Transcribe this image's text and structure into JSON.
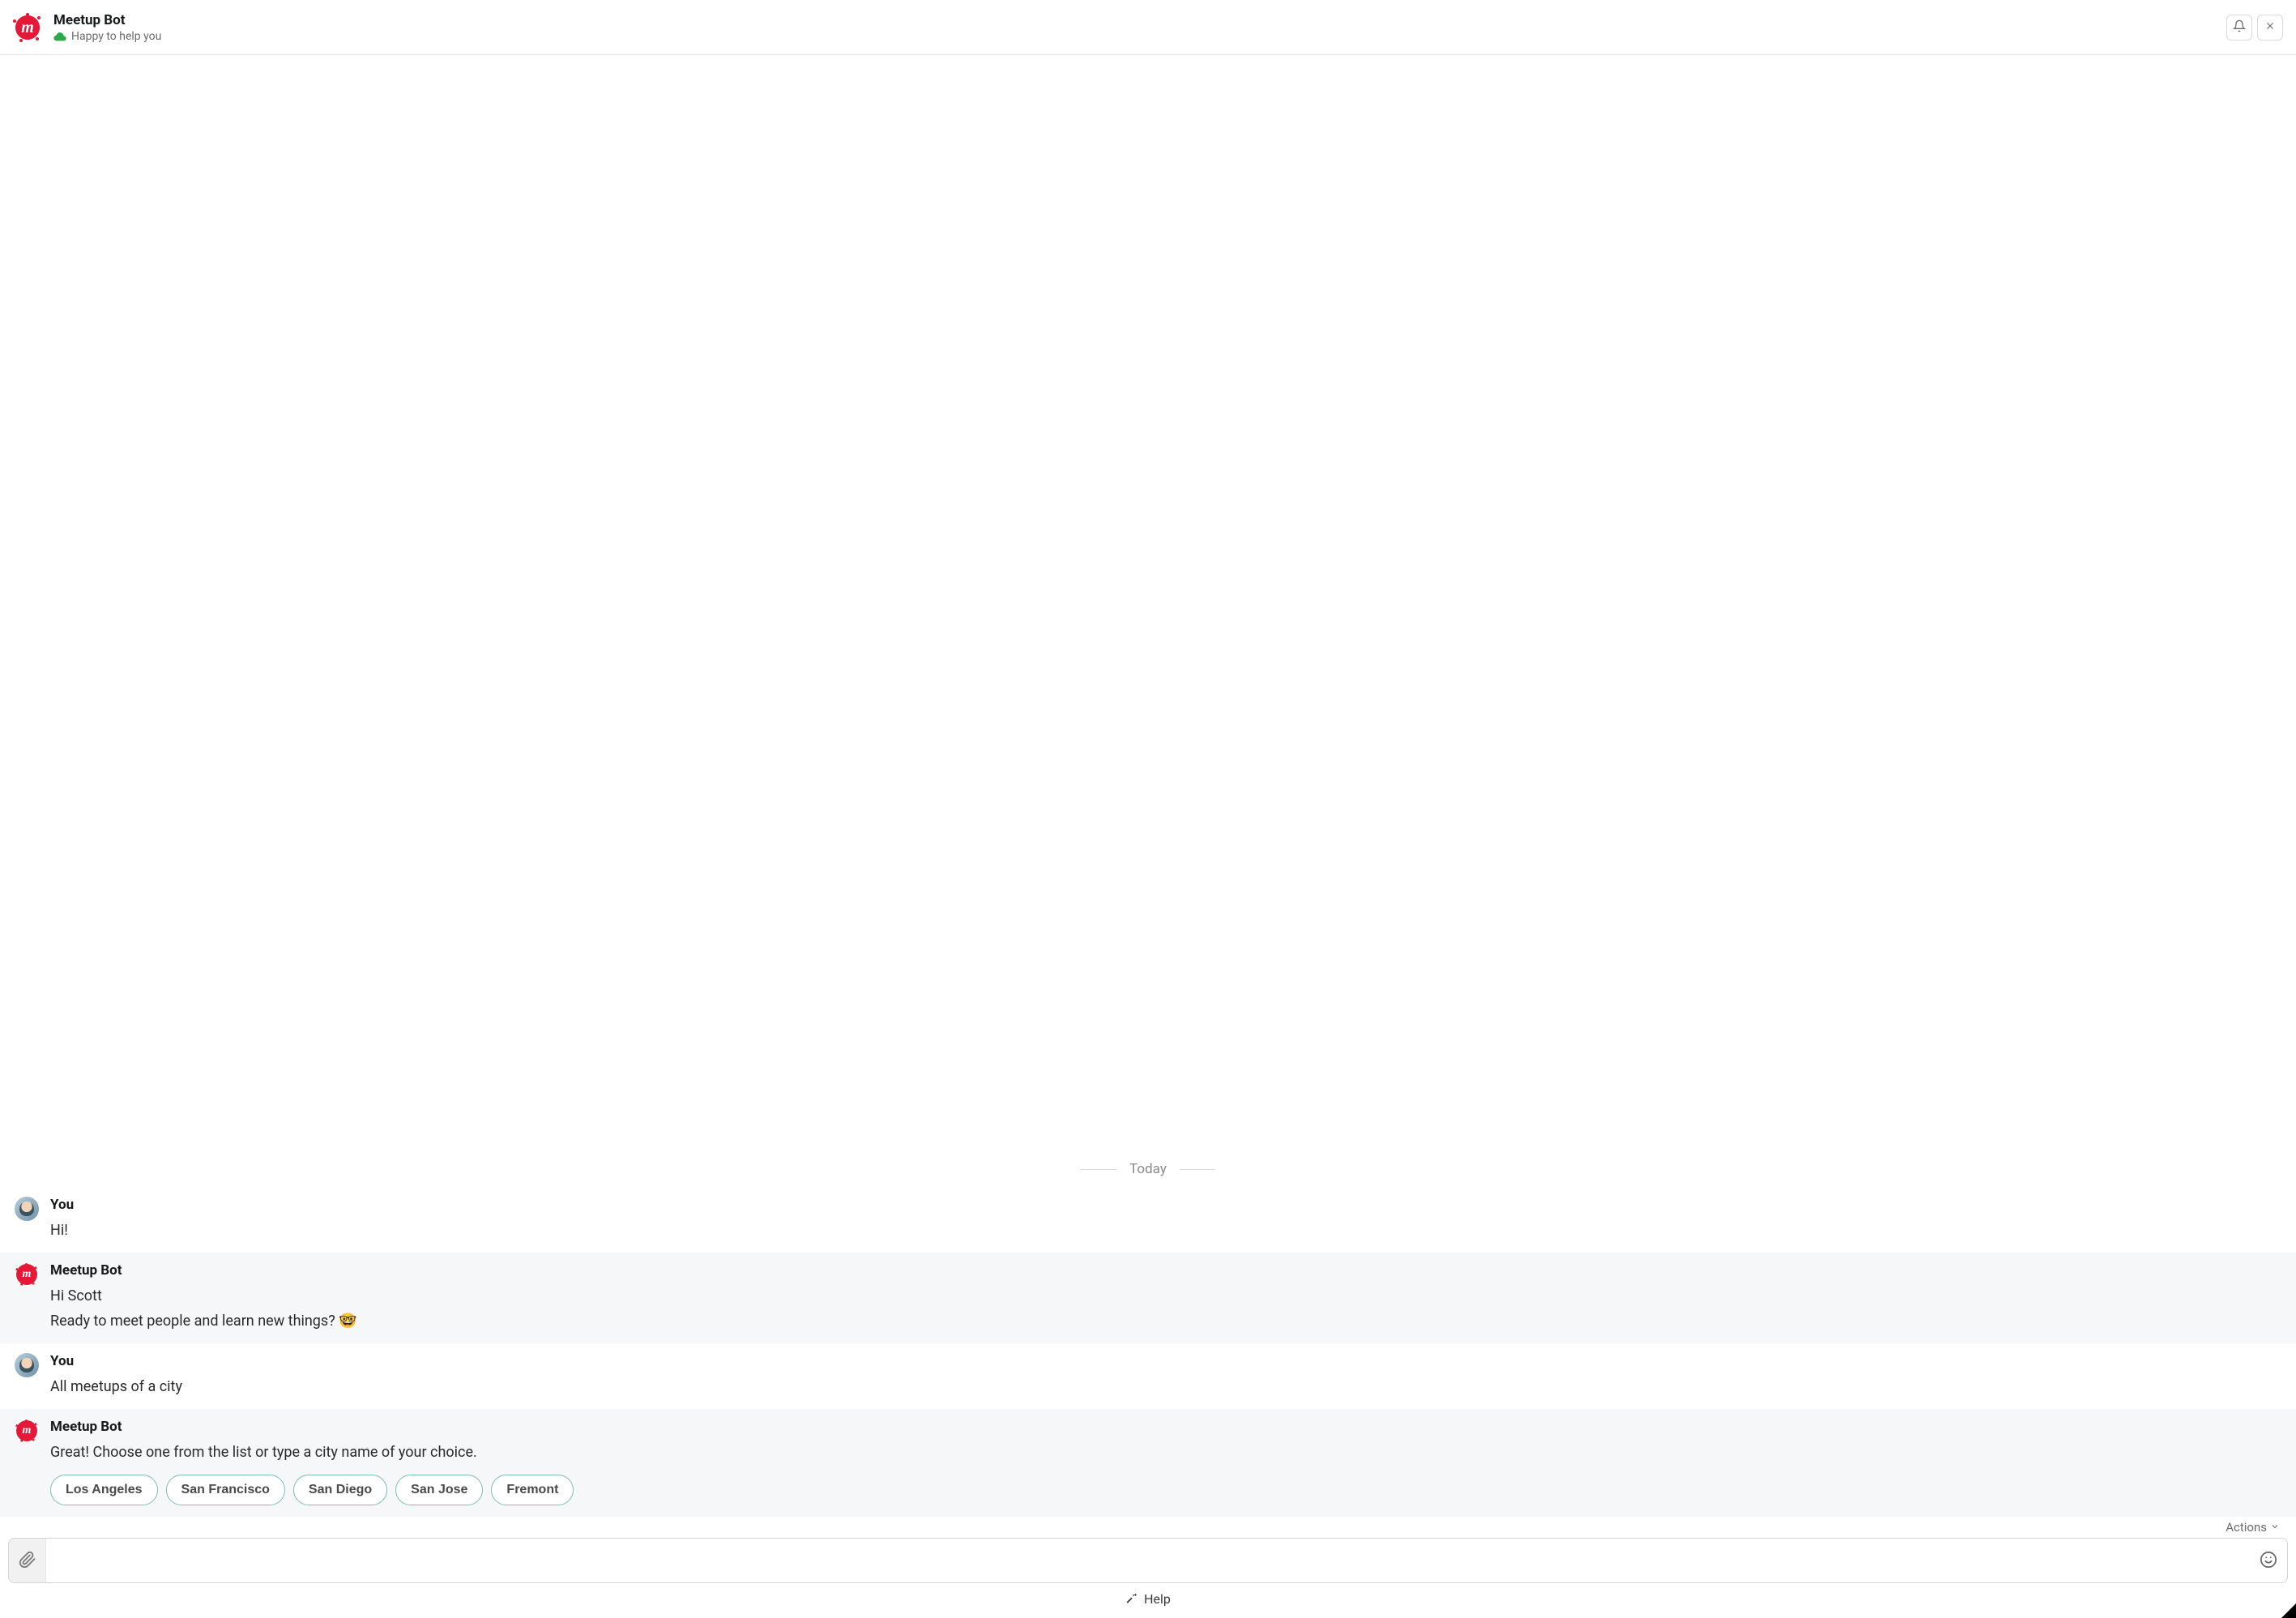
{
  "header": {
    "title": "Meetup Bot",
    "status_text": "Happy to help you"
  },
  "date_separator": "Today",
  "messages": [
    {
      "sender_label": "You",
      "sender_type": "user",
      "lines": [
        "Hi!"
      ]
    },
    {
      "sender_label": "Meetup Bot",
      "sender_type": "bot",
      "lines": [
        "Hi Scott",
        "Ready to meet people and learn new things? 🤓"
      ]
    },
    {
      "sender_label": "You",
      "sender_type": "user",
      "lines": [
        "All meetups of a city"
      ]
    },
    {
      "sender_label": "Meetup Bot",
      "sender_type": "bot",
      "lines": [
        "Great! Choose one from the list or type a city name of your choice."
      ],
      "chips": [
        "Los Angeles",
        "San Francisco",
        "San Diego",
        "San Jose",
        "Fremont"
      ]
    }
  ],
  "composer": {
    "actions_label": "Actions",
    "input_value": "",
    "input_placeholder": ""
  },
  "footer": {
    "help_label": "Help"
  }
}
